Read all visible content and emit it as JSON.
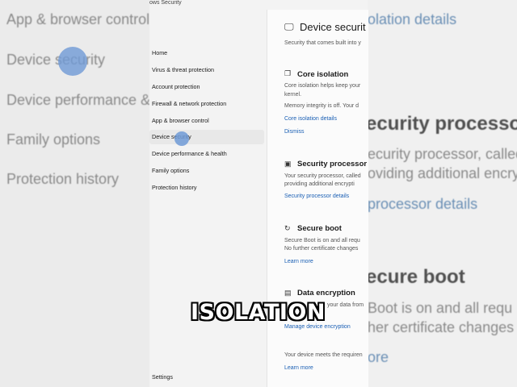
{
  "background_left": {
    "items": [
      "App & browser control",
      "Device security",
      "Device performance & health",
      "Family options",
      "Protection history"
    ]
  },
  "background_right": {
    "link_top": "olation details",
    "heading1": "ecurity processor",
    "line1": "ecurity processor, called",
    "line2": "oviding additional encryptio",
    "link2": "processor details",
    "heading2": "ecure boot",
    "line3": "Boot is on and all requ",
    "line4": "her certificate changes",
    "link3": "ore"
  },
  "window": {
    "title": "ows Security",
    "nav": [
      {
        "label": "Home"
      },
      {
        "label": "Virus & threat protection"
      },
      {
        "label": "Account protection"
      },
      {
        "label": "Firewall & network protection"
      },
      {
        "label": "App & browser control"
      },
      {
        "label": "Device security",
        "selected": true
      },
      {
        "label": "Device performance & health"
      },
      {
        "label": "Family options"
      },
      {
        "label": "Protection history"
      }
    ],
    "settings_label": "Settings"
  },
  "content": {
    "title": "Device securit",
    "subtitle": "Security that comes built into y",
    "core_isolation": {
      "title": "Core isolation",
      "desc1": "Core isolation helps keep your",
      "desc2": "kernel.",
      "status": "Memory integrity is off. Your d",
      "link": "Core isolation details",
      "dismiss": "Dismiss"
    },
    "security_processor": {
      "title": "Security processor",
      "desc1": "Your security processor, called",
      "desc2": "providing additional encrypti",
      "link": "Security processor details"
    },
    "secure_boot": {
      "title": "Secure boot",
      "desc1": "Secure Boot is on and all requ",
      "desc2": "No further certificate changes",
      "link": "Learn more"
    },
    "data_encryption": {
      "title": "Data encryption",
      "desc1": "your data from",
      "link": "Manage device encryption"
    },
    "footer": {
      "text": "Your device meets the requiren",
      "link": "Learn more"
    }
  },
  "caption": "ISOLATION"
}
